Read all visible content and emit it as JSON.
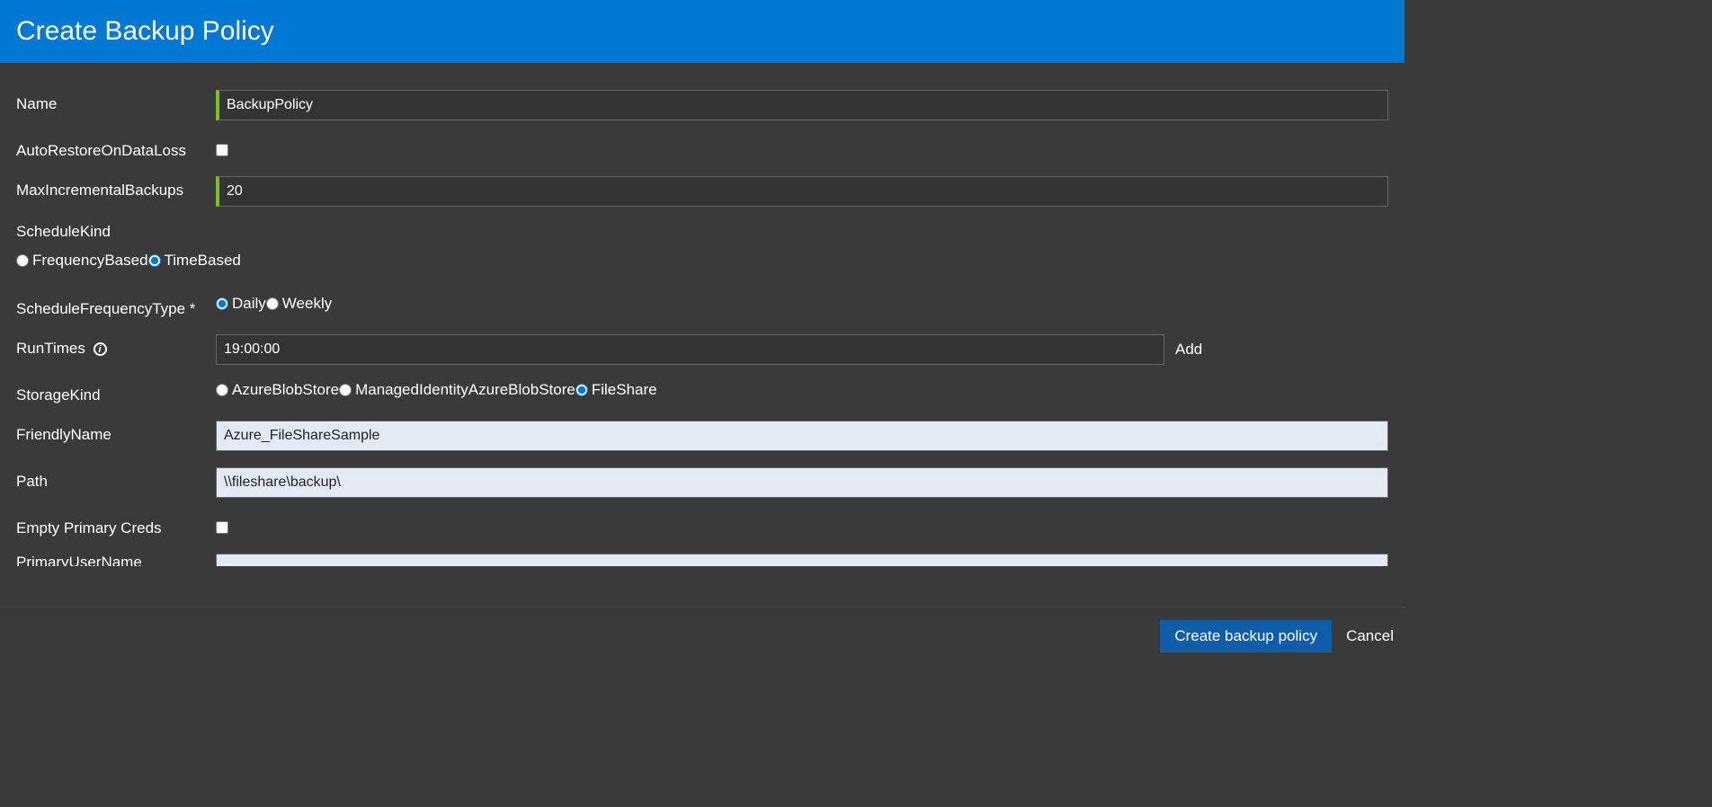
{
  "header": {
    "title": "Create Backup Policy"
  },
  "form": {
    "name_label": "Name",
    "name_value": "BackupPolicy",
    "auto_restore_label": "AutoRestoreOnDataLoss",
    "auto_restore_checked": false,
    "max_incremental_label": "MaxIncrementalBackups",
    "max_incremental_value": "20",
    "schedule_kind_label": "ScheduleKind",
    "schedule_kind_options": {
      "frequency_based": "FrequencyBased",
      "time_based": "TimeBased"
    },
    "schedule_kind_selected": "TimeBased",
    "schedule_frequency_type_label": "ScheduleFrequencyType *",
    "schedule_frequency_options": {
      "daily": "Daily",
      "weekly": "Weekly"
    },
    "schedule_frequency_selected": "Daily",
    "run_times_label": "RunTimes",
    "run_times_value": "19:00:00",
    "add_label": "Add",
    "storage_kind_label": "StorageKind",
    "storage_kind_options": {
      "azure_blob": "AzureBlobStore",
      "managed_identity_blob": "ManagedIdentityAzureBlobStore",
      "file_share": "FileShare"
    },
    "storage_kind_selected": "FileShare",
    "friendly_name_label": "FriendlyName",
    "friendly_name_value": "Azure_FileShareSample",
    "path_label": "Path",
    "path_value": "\\\\fileshare\\backup\\",
    "empty_primary_creds_label": "Empty Primary Creds",
    "empty_primary_creds_checked": false,
    "primary_user_name_label": "PrimaryUserName"
  },
  "footer": {
    "create_button": "Create backup policy",
    "cancel_button": "Cancel"
  }
}
